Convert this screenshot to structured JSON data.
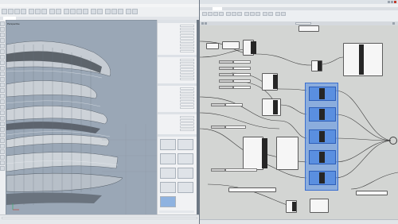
{
  "rhino": {
    "title": "",
    "menu": [],
    "toolbar_tabs": [],
    "viewport": {
      "name": "Perspective"
    },
    "properties": {
      "section_title": "",
      "rows": []
    },
    "status_items": []
  },
  "grasshopper": {
    "title": "",
    "menu": [],
    "tabs": [],
    "components": [],
    "status": ""
  },
  "colors": {
    "rhino_chrome": "#eef0f2",
    "viewport_bg": "#9aa7b6",
    "gh_canvas": "#d3d5d3",
    "gh_selection": "#5a8fe0",
    "component_dark": "#262626"
  }
}
